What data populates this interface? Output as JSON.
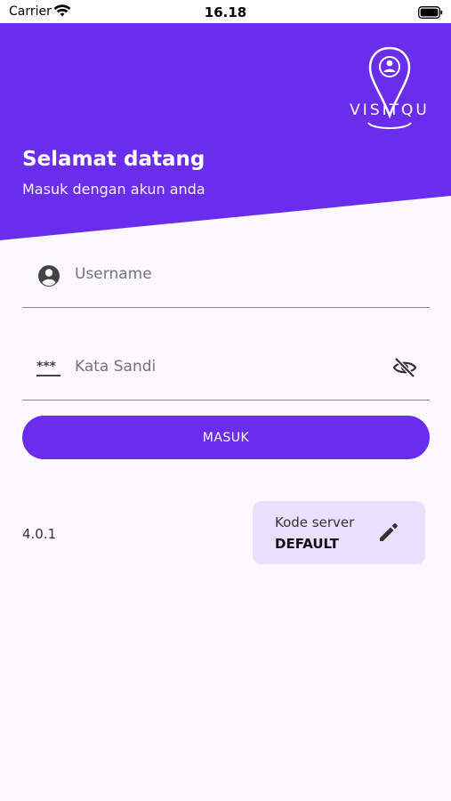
{
  "status_bar": {
    "carrier": "Carrier",
    "time": "16.18",
    "icons": [
      "wifi-icon",
      "battery-icon"
    ]
  },
  "header": {
    "logo_text": "VISITQU",
    "welcome_title": "Selamat datang",
    "welcome_subtitle": "Masuk dengan akun anda",
    "background_color": "#6b2ded"
  },
  "form": {
    "username": {
      "placeholder": "Username",
      "value": "",
      "icon": "account-circle-icon"
    },
    "password": {
      "placeholder": "Kata Sandi",
      "value": "",
      "icon": "password-icon",
      "toggle_icon": "eye-off-icon"
    },
    "login_label": "MASUK"
  },
  "footer": {
    "version": "4.0.1",
    "server_label": "Kode server",
    "server_value": "DEFAULT",
    "edit_icon": "pencil-icon"
  },
  "colors": {
    "primary": "#6b2ded",
    "card_bg": "#e9e0ff",
    "page_bg": "#fcf8ff"
  }
}
